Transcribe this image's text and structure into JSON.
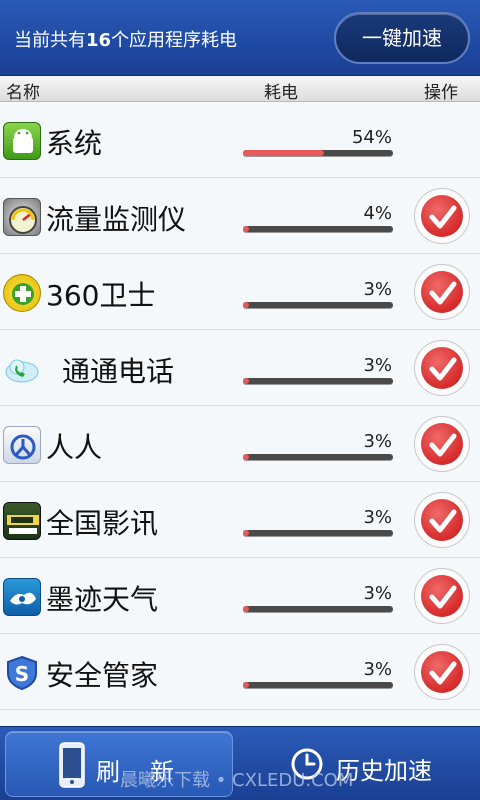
{
  "header": {
    "summary_prefix": "当前共有",
    "app_count": "16",
    "summary_suffix": "个应用程序耗电",
    "boost_label": "一键加速"
  },
  "columns": {
    "name": "名称",
    "power": "耗电",
    "action": "操作"
  },
  "apps": [
    {
      "name": "系统",
      "percent_label": "54%",
      "usage": 0.54,
      "has_action": false,
      "icon": "android-system-icon"
    },
    {
      "name": "流量监测仪",
      "percent_label": "4%",
      "usage": 0.04,
      "has_action": true,
      "icon": "speedometer-icon"
    },
    {
      "name": "360卫士",
      "percent_label": "3%",
      "usage": 0.03,
      "has_action": true,
      "icon": "360-plus-icon"
    },
    {
      "name": "通通电话",
      "percent_label": "3%",
      "usage": 0.03,
      "has_action": true,
      "icon": "cloud-phone-icon"
    },
    {
      "name": "人人",
      "percent_label": "3%",
      "usage": 0.03,
      "has_action": true,
      "icon": "renren-icon"
    },
    {
      "name": "全国影讯",
      "percent_label": "3%",
      "usage": 0.03,
      "has_action": true,
      "icon": "mtime-icon"
    },
    {
      "name": "墨迹天气",
      "percent_label": "3%",
      "usage": 0.03,
      "has_action": true,
      "icon": "moji-weather-icon"
    },
    {
      "name": "安全管家",
      "percent_label": "3%",
      "usage": 0.03,
      "has_action": true,
      "icon": "shield-s-icon"
    }
  ],
  "footer": {
    "refresh_label": "刷新",
    "history_label": "历史加速",
    "watermark": "晨曦乐下载 • CXLEDU.COM"
  },
  "colors": {
    "accent_blue": "#1f4aa3",
    "bar_fill": "#e55a5a",
    "check_red": "#d62a2a"
  }
}
